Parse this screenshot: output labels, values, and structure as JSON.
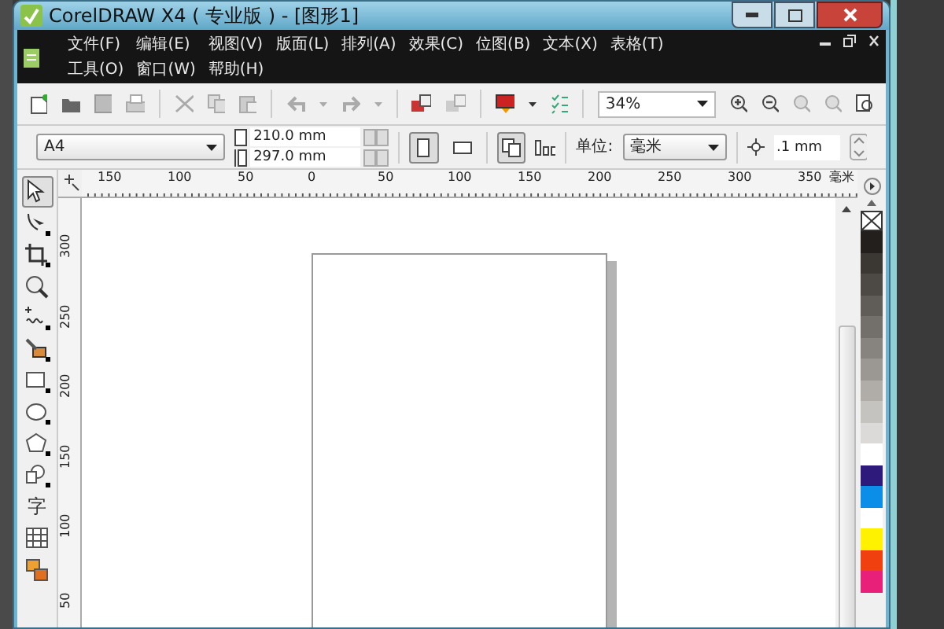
{
  "window": {
    "title": "CorelDRAW X4 ( 专业版 ) - [图形1]"
  },
  "menu": [
    "文件(F)",
    "编辑(E)",
    "视图(V)",
    "版面(L)",
    "排列(A)",
    "效果(C)",
    "位图(B)",
    "文本(X)",
    "表格(T)",
    "工具(O)",
    "窗口(W)",
    "帮助(H)"
  ],
  "standard_toolbar": {
    "zoom": "34%"
  },
  "property_bar": {
    "paper": "A4",
    "width": "210.0 mm",
    "height": "297.0 mm",
    "portrait_selected": true,
    "units_label": "单位:",
    "units": "毫米",
    "nudge": ".1 mm"
  },
  "toolbox": [
    {
      "kind": "pick",
      "selected": true
    },
    {
      "kind": "shape",
      "selected": false
    },
    {
      "kind": "crop",
      "selected": false
    },
    {
      "kind": "zoom",
      "selected": false
    },
    {
      "kind": "curve",
      "selected": false
    },
    {
      "kind": "smart",
      "selected": false
    },
    {
      "kind": "rect",
      "selected": false
    },
    {
      "kind": "ellipse",
      "selected": false
    },
    {
      "kind": "polygon",
      "selected": false
    },
    {
      "kind": "shapes",
      "selected": false
    },
    {
      "kind": "text",
      "label": "字",
      "selected": false
    },
    {
      "kind": "table",
      "selected": false
    },
    {
      "kind": "blend",
      "selected": false
    }
  ],
  "h_ruler": {
    "labels": [
      "150",
      "100",
      "50",
      "0",
      "50",
      "100",
      "150",
      "200",
      "250",
      "300",
      "350"
    ],
    "unit": "毫米"
  },
  "v_ruler": {
    "labels": [
      "300",
      "250",
      "200",
      "150",
      "100",
      "50"
    ]
  },
  "palette": [
    {
      "color": "#231f1c"
    },
    {
      "color": "#3b3834"
    },
    {
      "color": "#4d4a46"
    },
    {
      "color": "#605d59"
    },
    {
      "color": "#73706c"
    },
    {
      "color": "#878480"
    },
    {
      "color": "#9b9894"
    },
    {
      "color": "#b0ada9"
    },
    {
      "color": "#c5c3c0"
    },
    {
      "color": "#dcdad8"
    },
    {
      "color": "#ffffff"
    },
    {
      "color": "#2e1a7a"
    },
    {
      "color": "#0a8ee8"
    },
    {
      "color": "#ffffff"
    },
    {
      "color": "#fff200"
    },
    {
      "color": "#f04010"
    },
    {
      "color": "#e8207a"
    }
  ]
}
